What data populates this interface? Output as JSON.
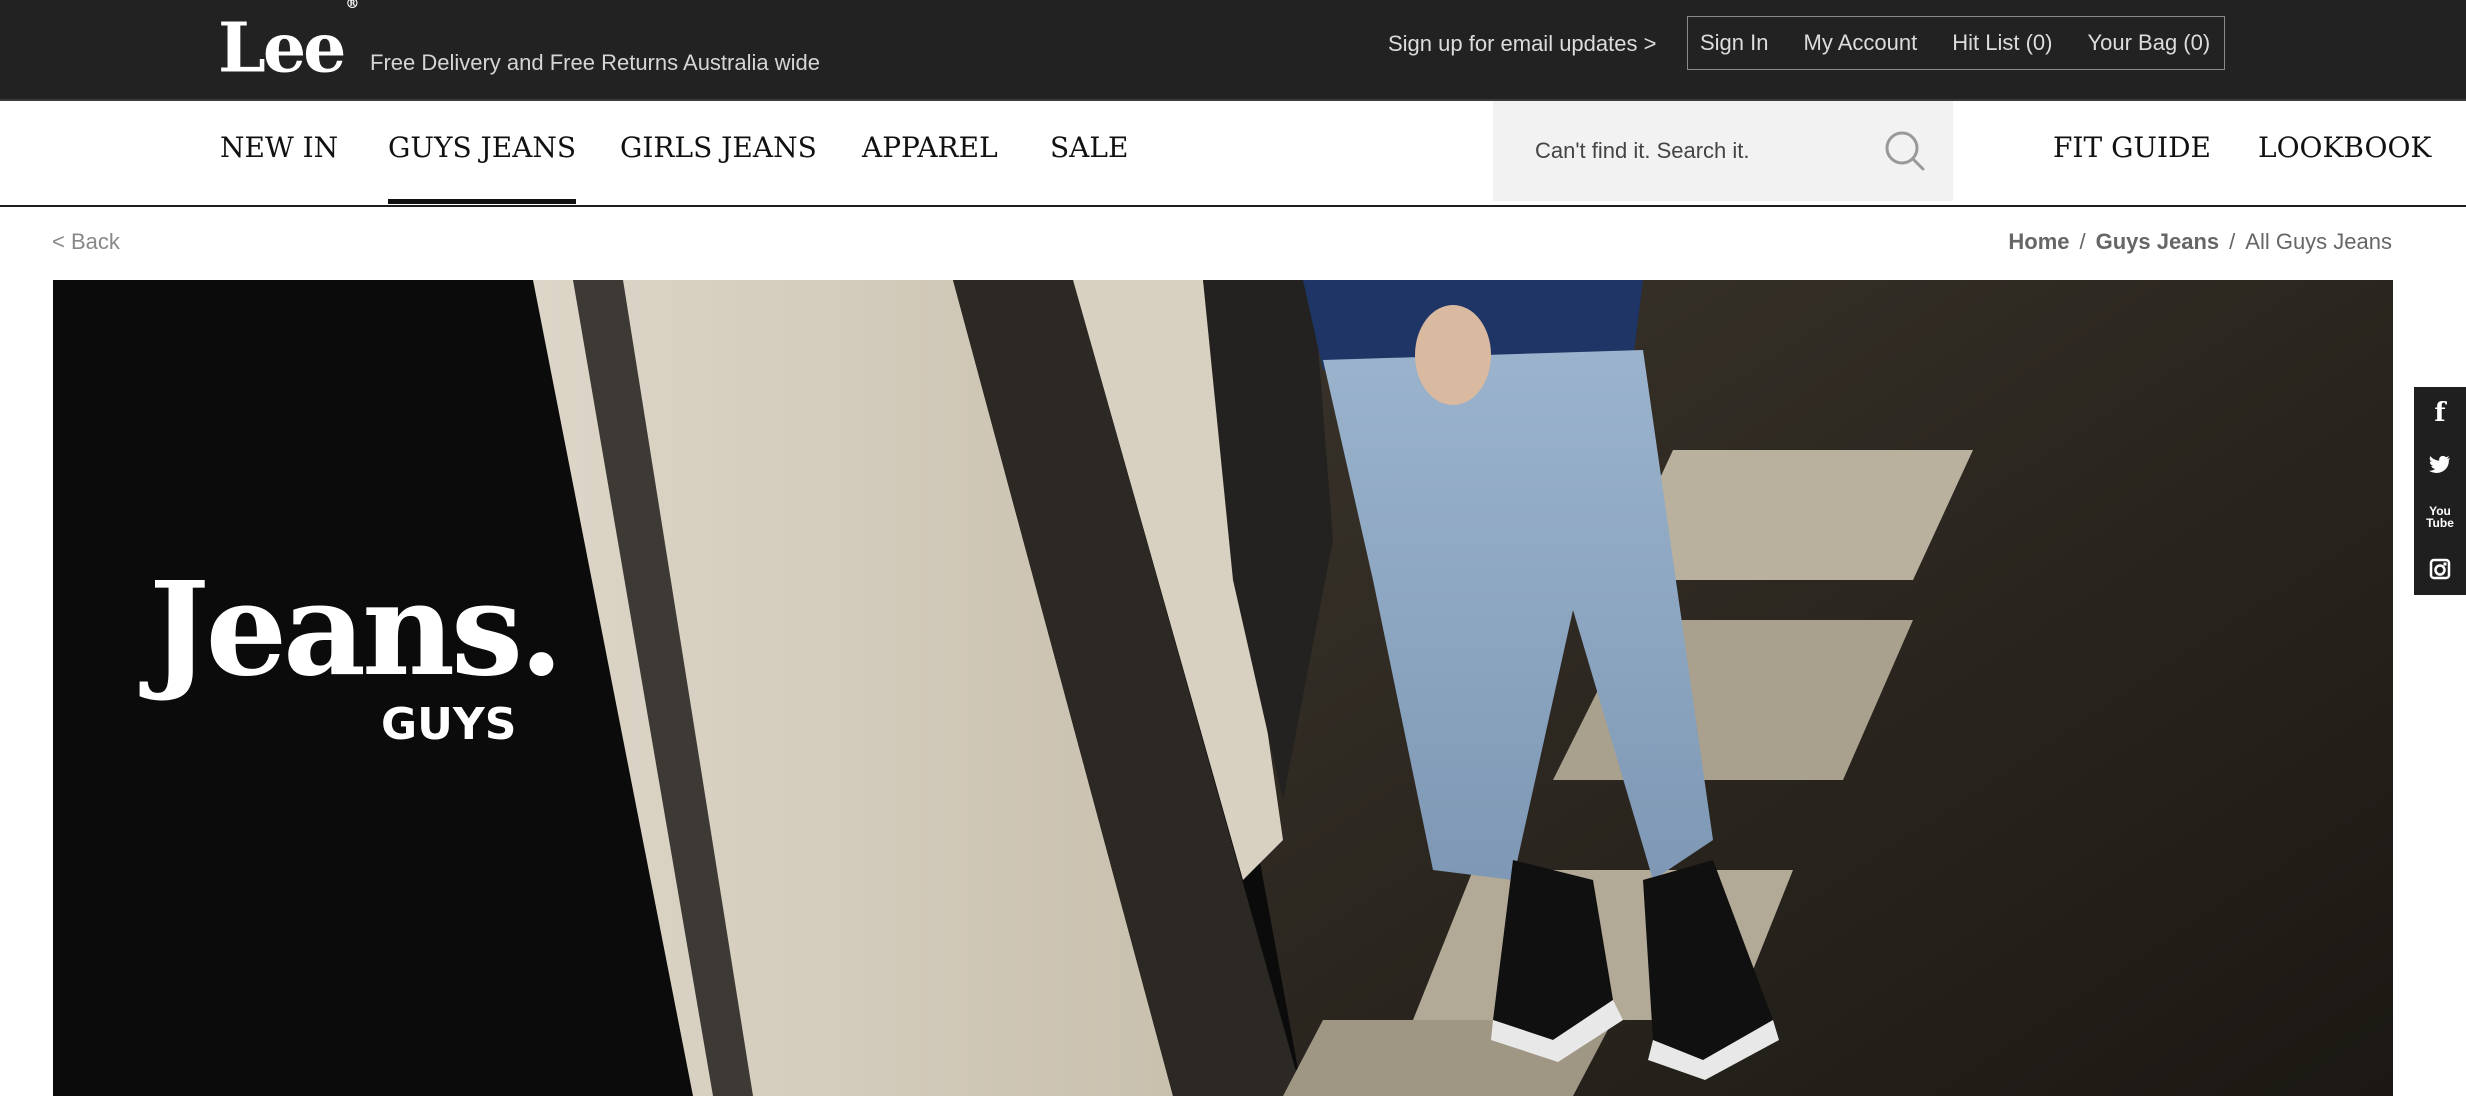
{
  "header": {
    "logo": "Lee",
    "logo_mark": "®",
    "tagline": "Free Delivery and Free Returns Australia wide",
    "signup": "Sign up for email updates >",
    "account_links": [
      "Sign In",
      "My Account",
      "Hit List (0)",
      "Your Bag (0)"
    ]
  },
  "nav": {
    "items": [
      "NEW IN",
      "GUYS JEANS",
      "GIRLS JEANS",
      "APPAREL",
      "SALE"
    ],
    "active": "GUYS JEANS",
    "search": {
      "placeholder": "Can't find it. Search it.",
      "icon": "search-icon"
    },
    "right_items": [
      "FIT GUIDE",
      "LOOKBOOK"
    ]
  },
  "subbar": {
    "back": "< Back",
    "breadcrumb": [
      "Home",
      "Guys Jeans",
      "All Guys Jeans"
    ],
    "separator": "/"
  },
  "hero": {
    "title": "Jeans.",
    "subtitle": "GUYS"
  },
  "social": {
    "icons": [
      "facebook-icon",
      "twitter-icon",
      "youtube-icon",
      "instagram-icon"
    ],
    "facebook_glyph": "f",
    "youtube_glyph": "You Tube"
  },
  "colors": {
    "topbar": "#222222",
    "nav_text": "#111111",
    "search_bg": "#f2f2f2",
    "muted_text": "#888888"
  }
}
